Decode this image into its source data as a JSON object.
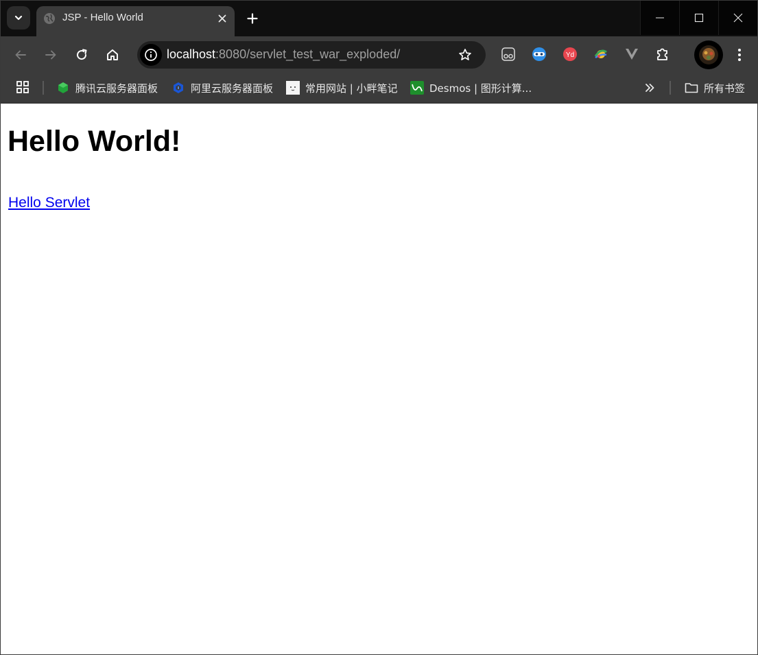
{
  "tab": {
    "title": "JSP - Hello World"
  },
  "address_bar": {
    "host": "localhost",
    "path": ":8080/servlet_test_war_exploded/"
  },
  "bookmarks": [
    {
      "label": "腾讯云服务器面板",
      "icon": "tencent-cloud-icon"
    },
    {
      "label": "阿里云服务器面板",
      "icon": "aliyun-icon"
    },
    {
      "label": "常用网站 | 小畔笔记",
      "icon": "notes-icon"
    },
    {
      "label": "Desmos | 图形计算...",
      "icon": "desmos-icon"
    }
  ],
  "all_bookmarks_label": "所有书签",
  "page": {
    "heading": "Hello World!",
    "link_label": "Hello Servlet"
  },
  "colors": {
    "link": "#0000ee",
    "chrome_bg": "#3b3b3b",
    "titlebar_bg": "#0f0f0f"
  }
}
